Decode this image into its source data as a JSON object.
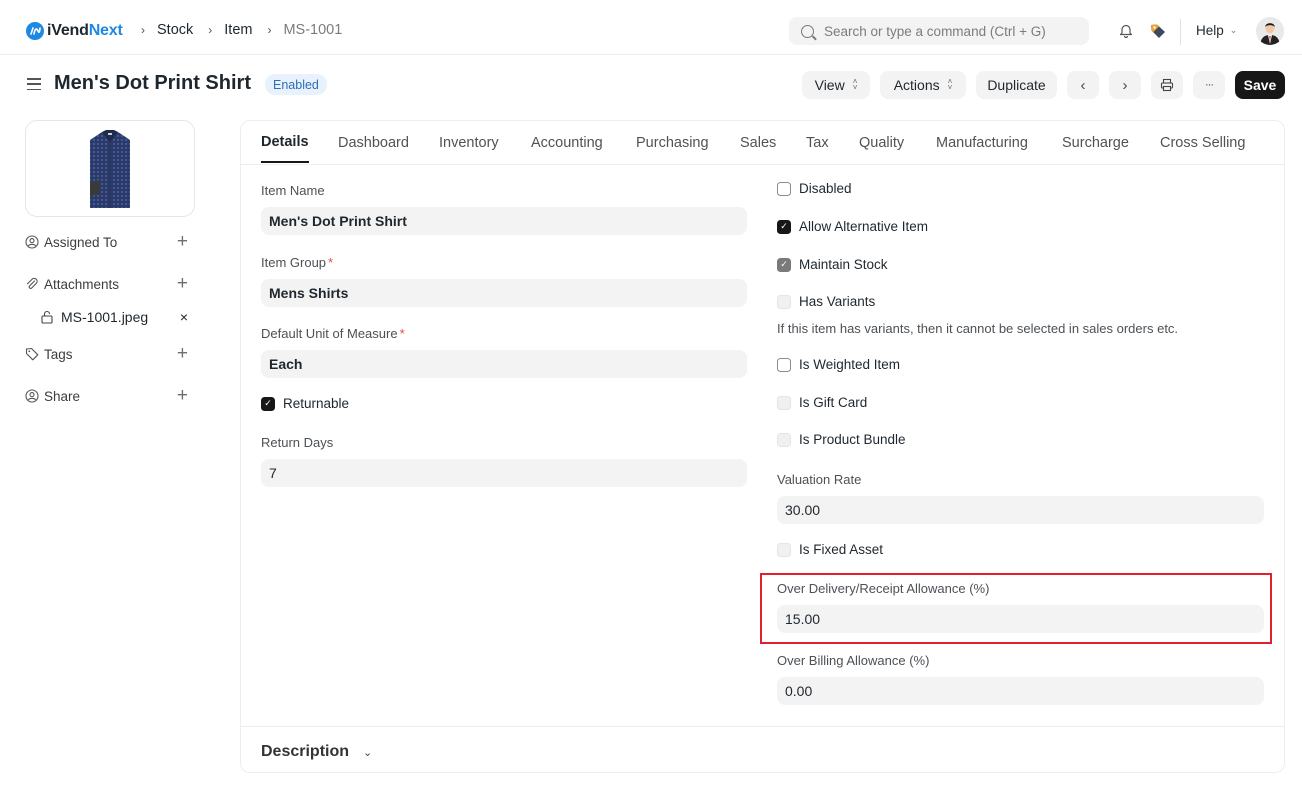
{
  "navbar": {
    "logo": {
      "prefix": "iVend",
      "suffix": "Next",
      "badge": "iV"
    },
    "breadcrumbs": [
      {
        "label": "Stock"
      },
      {
        "label": "Item"
      },
      {
        "label": "MS-1001"
      }
    ],
    "breadcrumb_separator": "›",
    "search": {
      "placeholder": "Search or type a command (Ctrl + G)",
      "value": ""
    },
    "help_label": "Help",
    "icons": [
      "bell-icon",
      "tag-icon",
      "avatar"
    ]
  },
  "page": {
    "title": "Men's Dot Print Shirt",
    "status": "Enabled",
    "toolbar": {
      "view_label": "View",
      "actions_label": "Actions",
      "duplicate_label": "Duplicate",
      "prev_glyph": "‹",
      "next_glyph": "›",
      "more_glyph": "···",
      "save_label": "Save"
    }
  },
  "sidebar": {
    "assigned_to": "Assigned To",
    "attachments": "Attachments",
    "attachment_files": [
      {
        "name": "MS-1001.jpeg"
      }
    ],
    "tags": "Tags",
    "share": "Share",
    "plus": "+",
    "remove": "×"
  },
  "tabs": [
    {
      "label": "Details",
      "active": true
    },
    {
      "label": "Dashboard"
    },
    {
      "label": "Inventory"
    },
    {
      "label": "Accounting"
    },
    {
      "label": "Purchasing"
    },
    {
      "label": "Sales"
    },
    {
      "label": "Tax"
    },
    {
      "label": "Quality"
    },
    {
      "label": "Manufacturing"
    },
    {
      "label": "Surcharge"
    },
    {
      "label": "Cross Selling"
    }
  ],
  "form": {
    "left": {
      "item_name": {
        "label": "Item Name",
        "value": "Men's Dot Print Shirt"
      },
      "item_group": {
        "label": "Item Group",
        "value": "Mens Shirts",
        "required": "*"
      },
      "uom": {
        "label": "Default Unit of Measure",
        "value": "Each",
        "required": "*"
      },
      "returnable": {
        "label": "Returnable",
        "checked": true
      },
      "return_days": {
        "label": "Return Days",
        "value": "7"
      }
    },
    "right": {
      "disabled": {
        "label": "Disabled",
        "checked": false
      },
      "allow_alternative": {
        "label": "Allow Alternative Item",
        "checked": true
      },
      "maintain_stock": {
        "label": "Maintain Stock",
        "checked": true,
        "readonly": true
      },
      "has_variants": {
        "label": "Has Variants",
        "checked": false,
        "readonly": true
      },
      "has_variants_help": "If this item has variants, then it cannot be selected in sales orders etc.",
      "is_weighted": {
        "label": "Is Weighted Item",
        "checked": false
      },
      "is_gift_card": {
        "label": "Is Gift Card",
        "checked": false,
        "readonly": true
      },
      "is_product_bundle": {
        "label": "Is Product Bundle",
        "checked": false,
        "readonly": true
      },
      "valuation_rate": {
        "label": "Valuation Rate",
        "value": "30.00"
      },
      "is_fixed_asset": {
        "label": "Is Fixed Asset",
        "checked": false,
        "readonly": true
      },
      "over_delivery": {
        "label": "Over Delivery/Receipt Allowance (%)",
        "value": "15.00",
        "highlighted": true
      },
      "over_billing": {
        "label": "Over Billing Allowance (%)",
        "value": "0.00"
      }
    }
  },
  "description_section": {
    "title": "Description"
  },
  "colors": {
    "brand": "#1e88e5",
    "primary_button": "#171717",
    "badge_bg": "#e8f2fd",
    "badge_text": "#2c6fbb",
    "highlight": "#e0202e"
  }
}
